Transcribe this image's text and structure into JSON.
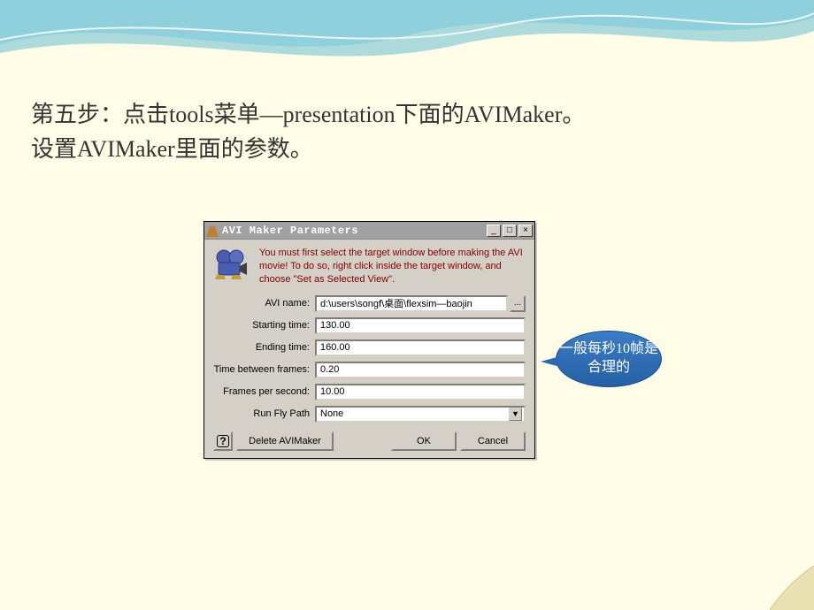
{
  "slide": {
    "text_line1": "第五步：点击tools菜单—presentation下面的AVIMaker。",
    "text_line2": " 设置AVIMaker里面的参数。"
  },
  "dialog": {
    "title": "AVI Maker Parameters",
    "instructions": "You must first select the target window before making the AVI movie! To do so, right click inside the target window, and choose \"Set as Selected View\".",
    "labels": {
      "avi_name": "AVI name:",
      "starting_time": "Starting time:",
      "ending_time": "Ending time:",
      "time_between_frames": "Time between frames:",
      "frames_per_second": "Frames per second:",
      "run_fly_path": "Run Fly Path"
    },
    "values": {
      "avi_name": "d:\\users\\songf\\桌面\\flexsim—baojin",
      "starting_time": "130.00",
      "ending_time": "160.00",
      "time_between_frames": "0.20",
      "frames_per_second": "10.00",
      "run_fly_path": "None"
    },
    "buttons": {
      "browse": "...",
      "help": "?",
      "delete": "Delete AVIMaker",
      "ok": "OK",
      "cancel": "Cancel"
    },
    "titlebar_buttons": {
      "minimize": "_",
      "maximize": "□",
      "close": "×"
    }
  },
  "callout": {
    "text": "一般每秒10帧是合理的"
  }
}
